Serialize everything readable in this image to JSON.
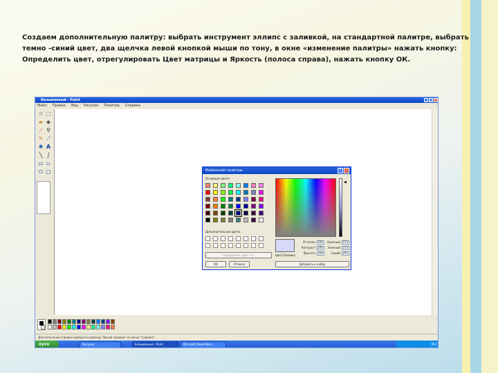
{
  "slide": {
    "instruction": "Создаем дополнительную палитру: выбрать инструмент эллипс с заливкой, на стандартной палитре, выбрать темно -синий цвет, два щелчка левой кнопкой мыши по тону, в окне «изменение палитры» нажать кнопку: Определить цвет, отрегулировать Цвет матрицы и Яркость (полоса справа), нажать кнопку ОК."
  },
  "paint": {
    "title": "Безымянный - Paint",
    "menu": [
      "Файл",
      "Правка",
      "Вид",
      "Рисунок",
      "Палитра",
      "Справка"
    ],
    "status_text": "Для получения справки выберите команду \"Вызов справки\" из меню \"Справка\".",
    "palette_colors": [
      "#000000",
      "#808080",
      "#800000",
      "#808000",
      "#008000",
      "#008080",
      "#000080",
      "#800080",
      "#808040",
      "#004040",
      "#0080ff",
      "#004080",
      "#8000ff",
      "#804000",
      "#ffffff",
      "#c0c0c0",
      "#ff0000",
      "#ffff00",
      "#00ff00",
      "#00ffff",
      "#0000ff",
      "#ff00ff",
      "#ffff80",
      "#00ff80",
      "#80ffff",
      "#8080ff",
      "#ff0080",
      "#ff8040"
    ]
  },
  "taskbar": {
    "start_label": "пуск",
    "tasks": [
      "Рисунки",
      "Безымянный - Paint",
      "Microsoft PowerPoint..."
    ],
    "clock": "RU"
  },
  "dialog": {
    "title": "Изменение палитры",
    "basic_colors_label": "Основные цвета:",
    "custom_colors_label": "Дополнительные цвета:",
    "define_button": "Определить цвет >>",
    "ok_button": "ОК",
    "cancel_button": "Отмена",
    "add_button": "Добавить в набор",
    "color_solid_label": "Цвет|Заливка",
    "basic_colors": [
      "#ff8080",
      "#ffff80",
      "#80ff80",
      "#00ff80",
      "#80ffff",
      "#0080ff",
      "#ff80c0",
      "#ff80ff",
      "#ff0000",
      "#ffff00",
      "#80ff00",
      "#00ff40",
      "#00ffff",
      "#0080c0",
      "#8080c0",
      "#ff00ff",
      "#804040",
      "#ff8040",
      "#00ff00",
      "#008080",
      "#004080",
      "#8080ff",
      "#800040",
      "#ff0080",
      "#800000",
      "#ff8000",
      "#008000",
      "#008040",
      "#0000ff",
      "#0000a0",
      "#800080",
      "#8000ff",
      "#400000",
      "#804000",
      "#004000",
      "#004040",
      "#000080",
      "#000040",
      "#400040",
      "#400080",
      "#000000",
      "#808000",
      "#808040",
      "#808080",
      "#408080",
      "#c0c0c0",
      "#400040",
      "#ffffff"
    ],
    "selected_index": 36,
    "fields": {
      "hue_label": "Оттенок:",
      "hue_value": "160",
      "sat_label": "Контраст:",
      "sat_value": "240",
      "lum_label": "Яркость:",
      "lum_value": "220",
      "red_label": "Красный:",
      "red_value": "213",
      "green_label": "Зеленый:",
      "green_value": "213",
      "blue_label": "Синий:",
      "blue_value": "255"
    }
  }
}
